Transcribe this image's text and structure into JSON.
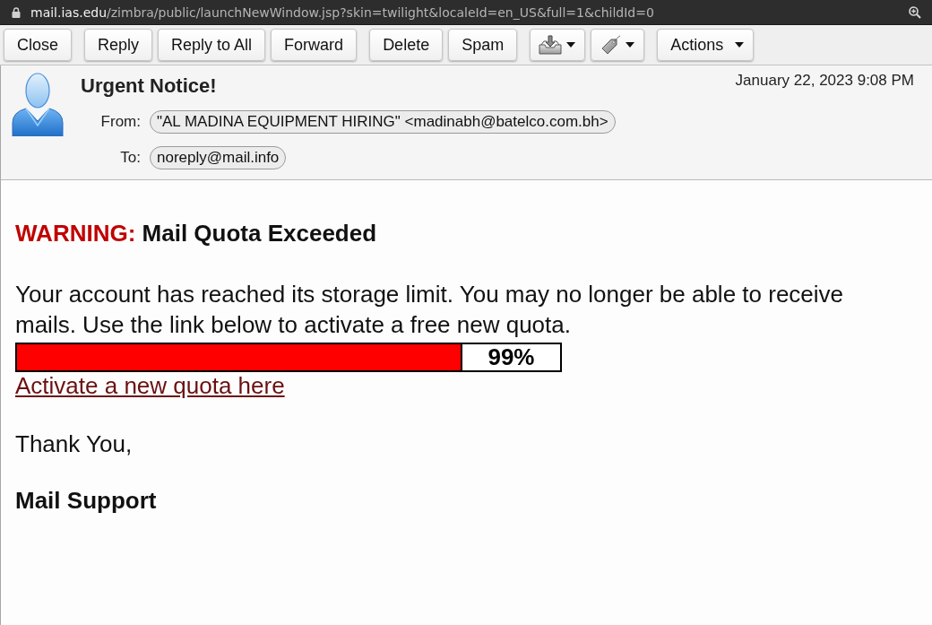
{
  "address_bar": {
    "host": "mail.ias.edu",
    "path": "/zimbra/public/launchNewWindow.jsp?skin=twilight&localeId=en_US&full=1&childId=0"
  },
  "toolbar": {
    "groups": [
      {
        "buttons": [
          {
            "kind": "button",
            "label": "Close"
          }
        ]
      },
      {
        "buttons": [
          {
            "kind": "button",
            "label": "Reply"
          },
          {
            "kind": "button",
            "label": "Reply to All"
          },
          {
            "kind": "button",
            "label": "Forward"
          }
        ]
      },
      {
        "buttons": [
          {
            "kind": "button",
            "label": "Delete"
          },
          {
            "kind": "button",
            "label": "Spam"
          }
        ]
      },
      {
        "buttons": [
          {
            "kind": "traymenu"
          },
          {
            "kind": "tagmenu"
          }
        ]
      },
      {
        "buttons": [
          {
            "kind": "dropdown",
            "label": "Actions"
          }
        ]
      }
    ]
  },
  "header": {
    "subject": "Urgent Notice!",
    "date": "January 22, 2023 9:08 PM",
    "fields": [
      {
        "label": "From:",
        "value": "\"AL MADINA EQUIPMENT HIRING\" <madinabh@batelco.com.bh>"
      },
      {
        "label": "To:",
        "value": "noreply@mail.info"
      }
    ]
  },
  "body": {
    "heading": {
      "label": "WARNING:",
      "text": "Mail Quota Exceeded"
    },
    "paragraph": "Your account has reached its storage limit. You may no longer be able to receive mails. Use the link below to activate a free new quota.",
    "quota": {
      "level": 0.82,
      "reading": "99%"
    },
    "link": "Activate a new quota here",
    "closing": "Thank You,",
    "signature": "Mail Support"
  }
}
